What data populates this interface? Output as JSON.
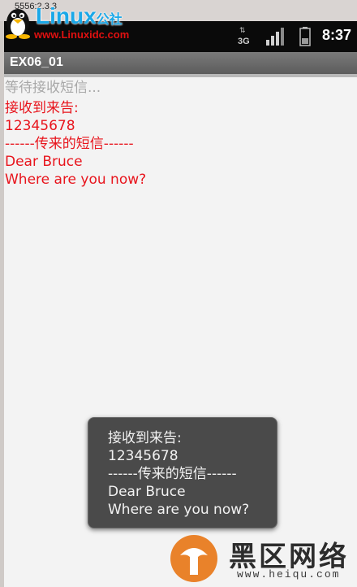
{
  "window": {
    "title": "5556:2.3.3"
  },
  "watermark_top": {
    "brand": "Linux",
    "brand_cn": "公社",
    "url": "www.Linuxidc.com"
  },
  "status_bar": {
    "network": "3G",
    "time": "8:37"
  },
  "app": {
    "title": "EX06_01"
  },
  "content": {
    "hint": "等待接收短信...",
    "message_lines": [
      "接收到来告:",
      "12345678",
      "------传来的短信------",
      "Dear Bruce",
      "Where are you now?"
    ]
  },
  "toast": {
    "lines": [
      "接收到来告:",
      "12345678",
      "------传来的短信------",
      "Dear Bruce",
      "Where are you now?"
    ]
  },
  "watermark_bottom": {
    "text": "黑区网络",
    "url": "www.heiqu.com"
  },
  "colors": {
    "message_text": "#e8141c",
    "hint_text": "#a8a8a8",
    "toast_bg": "#4a4a4a",
    "brand_blue": "#1aa8e8"
  }
}
